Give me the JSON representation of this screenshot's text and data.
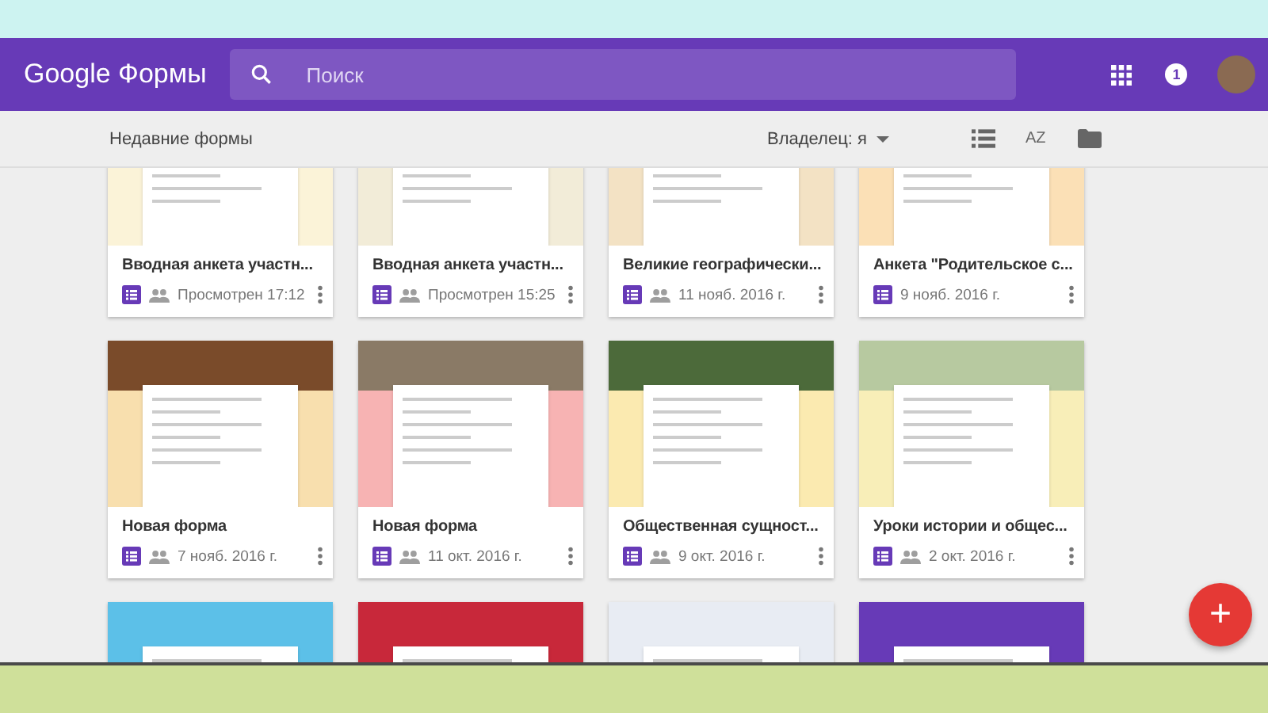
{
  "header": {
    "logo": "Google Формы",
    "search": {
      "placeholder": "Поиск"
    },
    "notifications": "1"
  },
  "toolbar": {
    "title": "Недавние формы",
    "owner_filter": "Владелец: я",
    "sort_label": "AZ"
  },
  "forms": [
    {
      "title": "Вводная анкета участн...",
      "shared": true,
      "date": "Просмотрен 17:12",
      "color": "#fbf3d8"
    },
    {
      "title": "Вводная анкета участн...",
      "shared": true,
      "date": "Просмотрен 15:25",
      "color": "#f2ecd8"
    },
    {
      "title": "Великие географически...",
      "shared": true,
      "date": "11 нояб. 2016 г.",
      "color": "#f3e2c4"
    },
    {
      "title": "Анкета \"Родительское с...",
      "shared": false,
      "date": "9 нояб. 2016 г.",
      "color": "#fbe0b6"
    },
    {
      "title": "Новая форма",
      "shared": true,
      "date": "7 нояб. 2016 г.",
      "color": "#f8dfae"
    },
    {
      "title": "Новая форма",
      "shared": true,
      "date": "11 окт. 2016 г.",
      "color": "#f7b3b3"
    },
    {
      "title": "Общественная сущност...",
      "shared": true,
      "date": "9 окт. 2016 г.",
      "color": "#fbeab0"
    },
    {
      "title": "Уроки истории и общес...",
      "shared": true,
      "date": "2 окт. 2016 г.",
      "color": "#f8eeb8"
    },
    {
      "color": "#5cc0e8"
    },
    {
      "color": "#c8283a"
    },
    {
      "color": "#e8ecf3"
    },
    {
      "color": "#673ab7"
    }
  ],
  "fab": "+"
}
